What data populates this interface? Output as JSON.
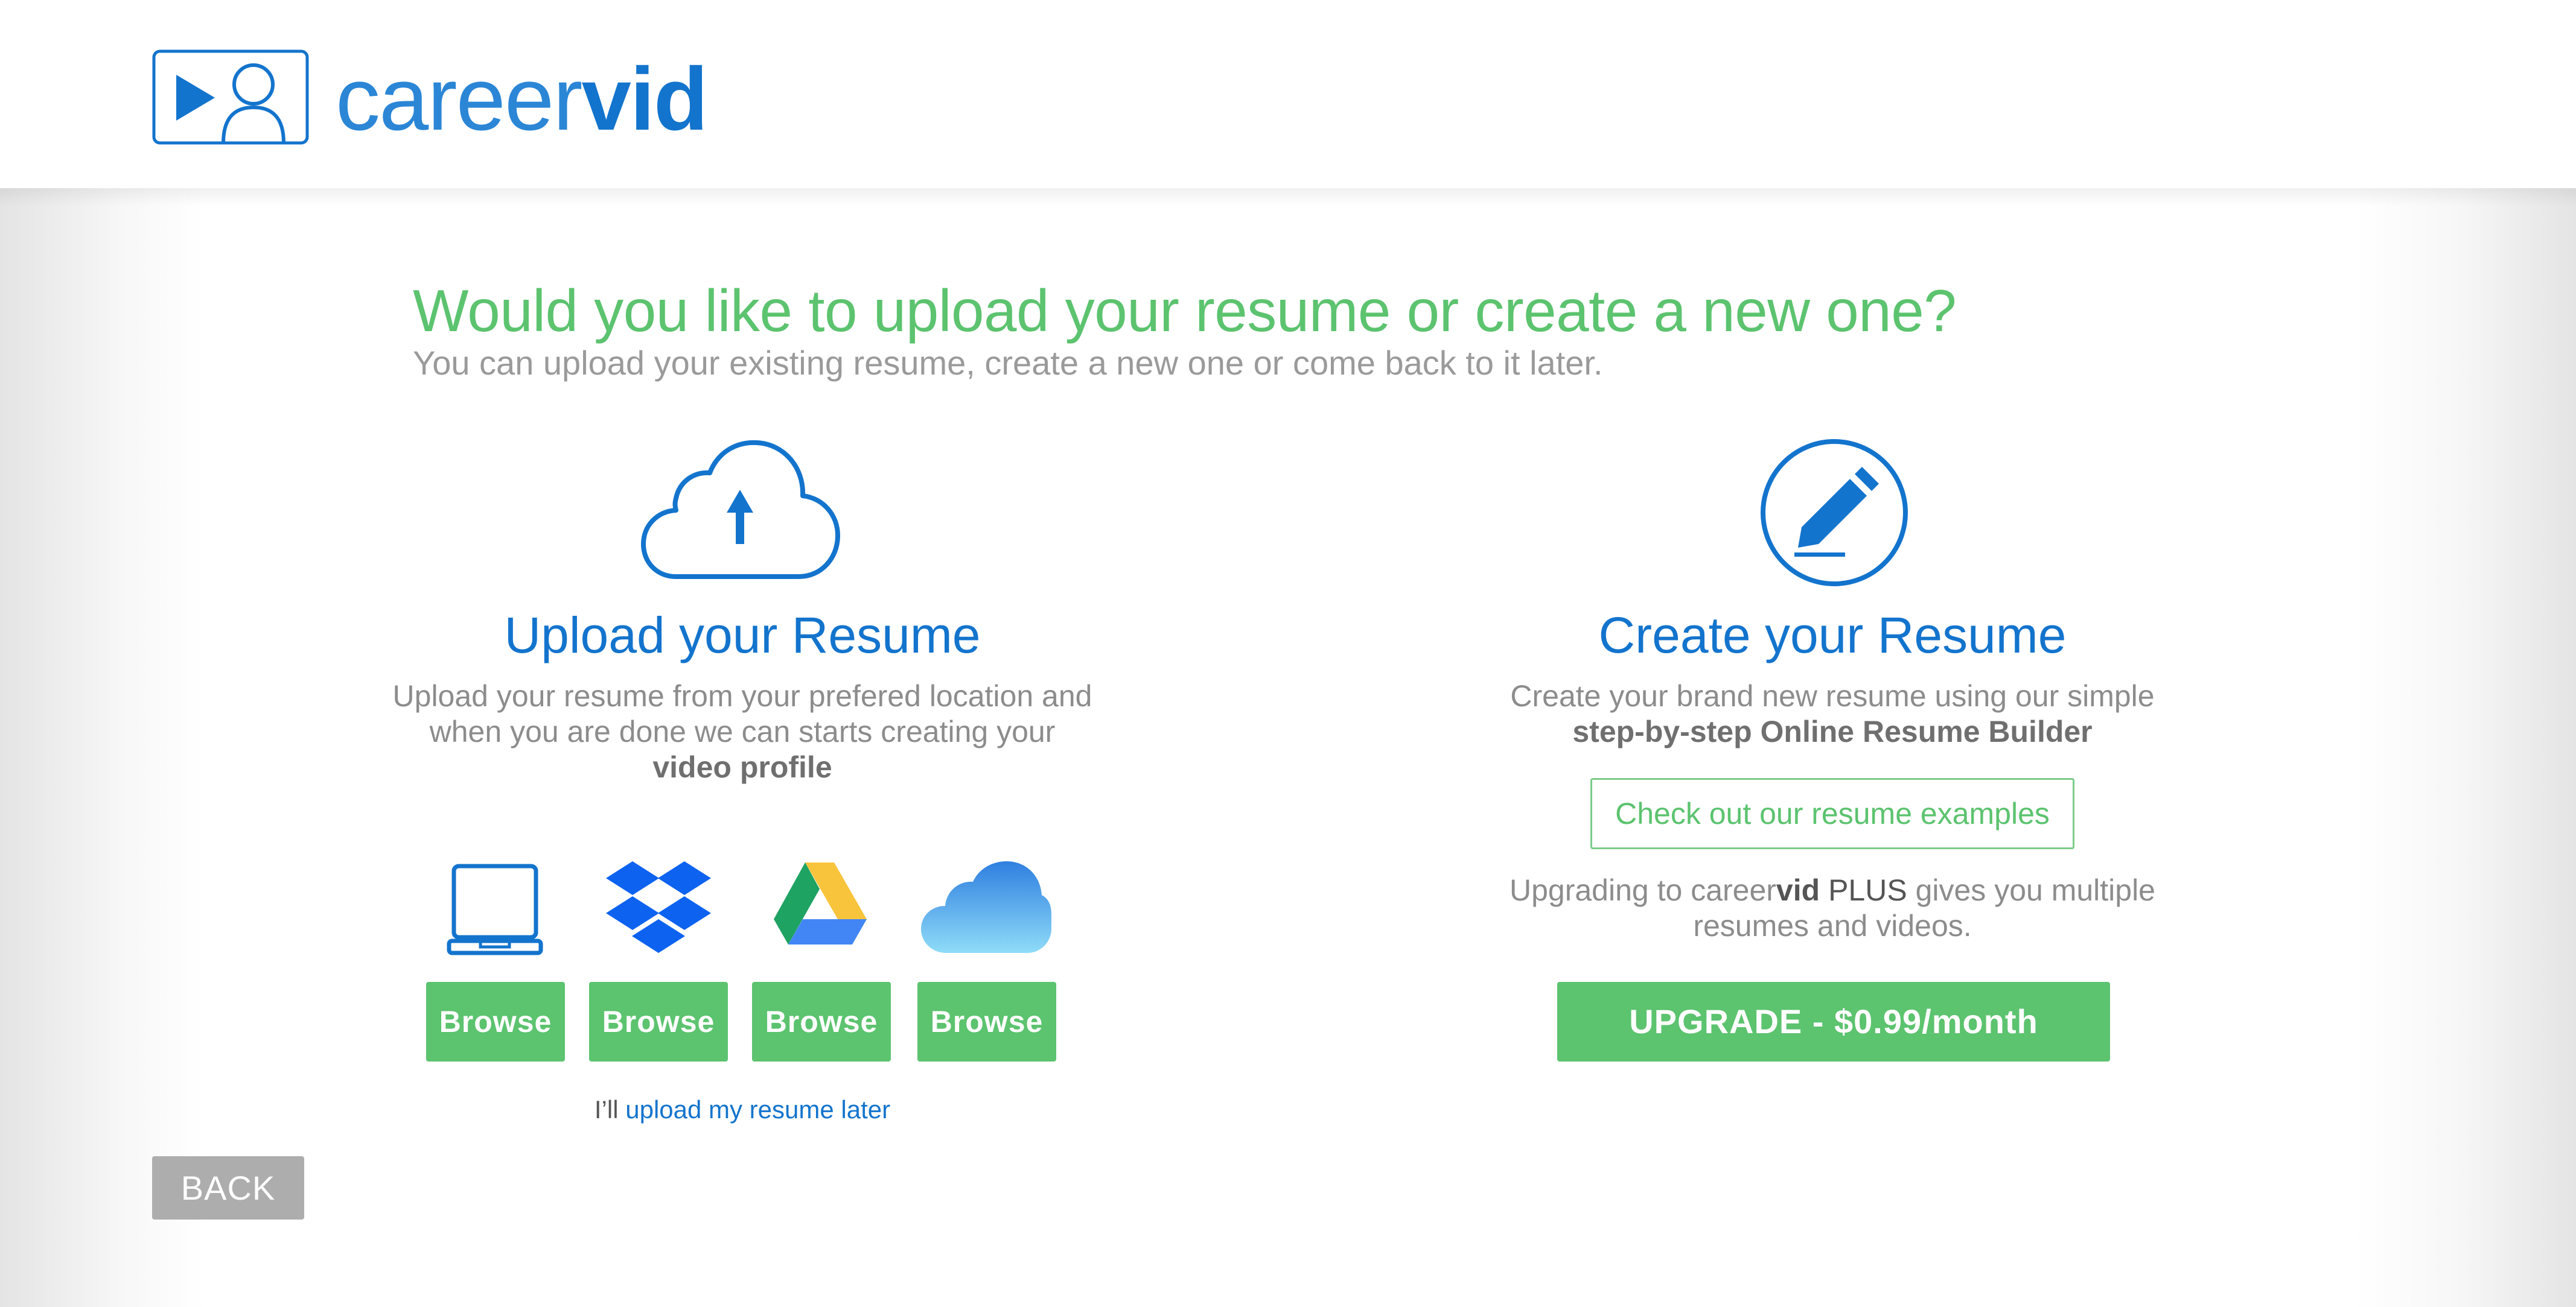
{
  "header": {
    "logo_light": "career",
    "logo_bold": "vid",
    "logo_icon": "video-profile-icon"
  },
  "main": {
    "title": "Would you like to upload your resume or create a new one?",
    "subtitle": "You can upload your existing resume, create a new one or come back to it later."
  },
  "upload": {
    "icon": "cloud-upload-icon",
    "title": "Upload your Resume",
    "desc_text": "Upload your resume from your prefered location and when you are done we can starts creating your ",
    "desc_bold": "video profile",
    "providers": [
      {
        "icon": "laptop-icon",
        "button": "Browse"
      },
      {
        "icon": "dropbox-icon",
        "button": "Browse"
      },
      {
        "icon": "google-drive-icon",
        "button": "Browse"
      },
      {
        "icon": "icloud-icon",
        "button": "Browse"
      }
    ],
    "later_prefix": "I’ll ",
    "later_link": "upload my resume later"
  },
  "create": {
    "icon": "pencil-circle-icon",
    "title": "Create your Resume",
    "desc_text": "Create your brand new resume using our simple",
    "desc_bold": "step-by-step Online Resume Builder",
    "examples_button": "Check out our resume examples",
    "upgrade_prefix": "Upgrading to ",
    "upgrade_brand_light": "career",
    "upgrade_brand_bold": "vid",
    "upgrade_plus": " PLUS",
    "upgrade_suffix": " gives you multiple resumes and videos.",
    "upgrade_button": "UPGRADE - $0.99/month"
  },
  "nav": {
    "back_button": "BACK"
  },
  "colors": {
    "brand_blue": "#1374cd",
    "accent_green": "#5cc36f",
    "muted_text": "#8c8c8c",
    "back_gray": "#adadad"
  }
}
